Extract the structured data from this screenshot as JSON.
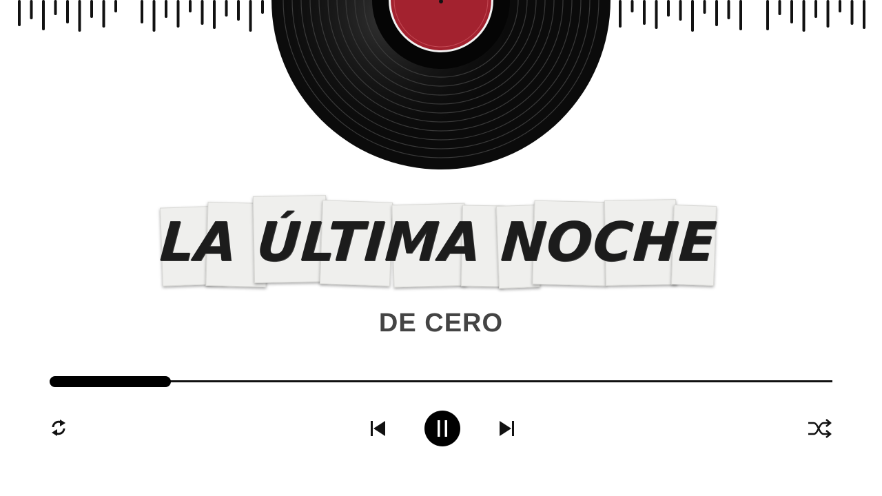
{
  "track": {
    "title": "LA ÚLTIMA NOCHE",
    "artist": "DE CERO"
  },
  "playback": {
    "progress": 0.155,
    "state": "playing"
  },
  "controls": {
    "repeat": "repeat-icon",
    "previous": "skip-previous-icon",
    "pause": "pause-icon",
    "next": "skip-next-icon",
    "shuffle": "shuffle-icon"
  },
  "colors": {
    "accent": "#000000",
    "label_red": "#a3222f",
    "artist_text": "#444444"
  }
}
